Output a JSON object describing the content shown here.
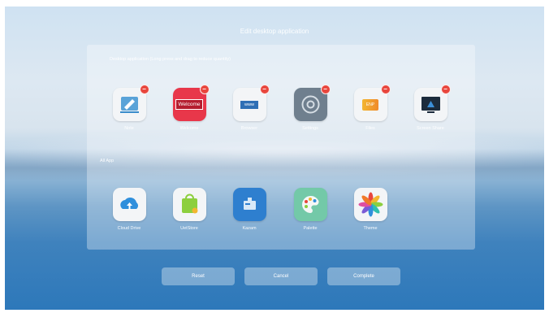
{
  "title": "Edit desktop application",
  "hint": "Desktop application (Long press and drag to reduce quantity)",
  "section_all_app": "All App",
  "desktop_apps": [
    {
      "label": "Note",
      "icon": "note-icon"
    },
    {
      "label": "Welcome",
      "icon": "welcome-icon",
      "tile_text": "Welcome"
    },
    {
      "label": "Browser",
      "icon": "browser-icon",
      "tile_text": "www"
    },
    {
      "label": "Settings",
      "icon": "settings-icon"
    },
    {
      "label": "Files",
      "icon": "files-icon",
      "tile_text": "ENP"
    },
    {
      "label": "Screen Share",
      "icon": "screen-share-icon"
    }
  ],
  "all_apps": [
    {
      "label": "Cloud Drive",
      "icon": "cloud-drive-icon"
    },
    {
      "label": "UetStore",
      "icon": "store-icon"
    },
    {
      "label": "Kazam",
      "icon": "kazam-icon"
    },
    {
      "label": "Palette",
      "icon": "palette-icon"
    },
    {
      "label": "Theme",
      "icon": "theme-icon"
    }
  ],
  "delete_glyph": "−",
  "buttons": {
    "reset": "Reset",
    "cancel": "Cancel",
    "complete": "Complete"
  }
}
